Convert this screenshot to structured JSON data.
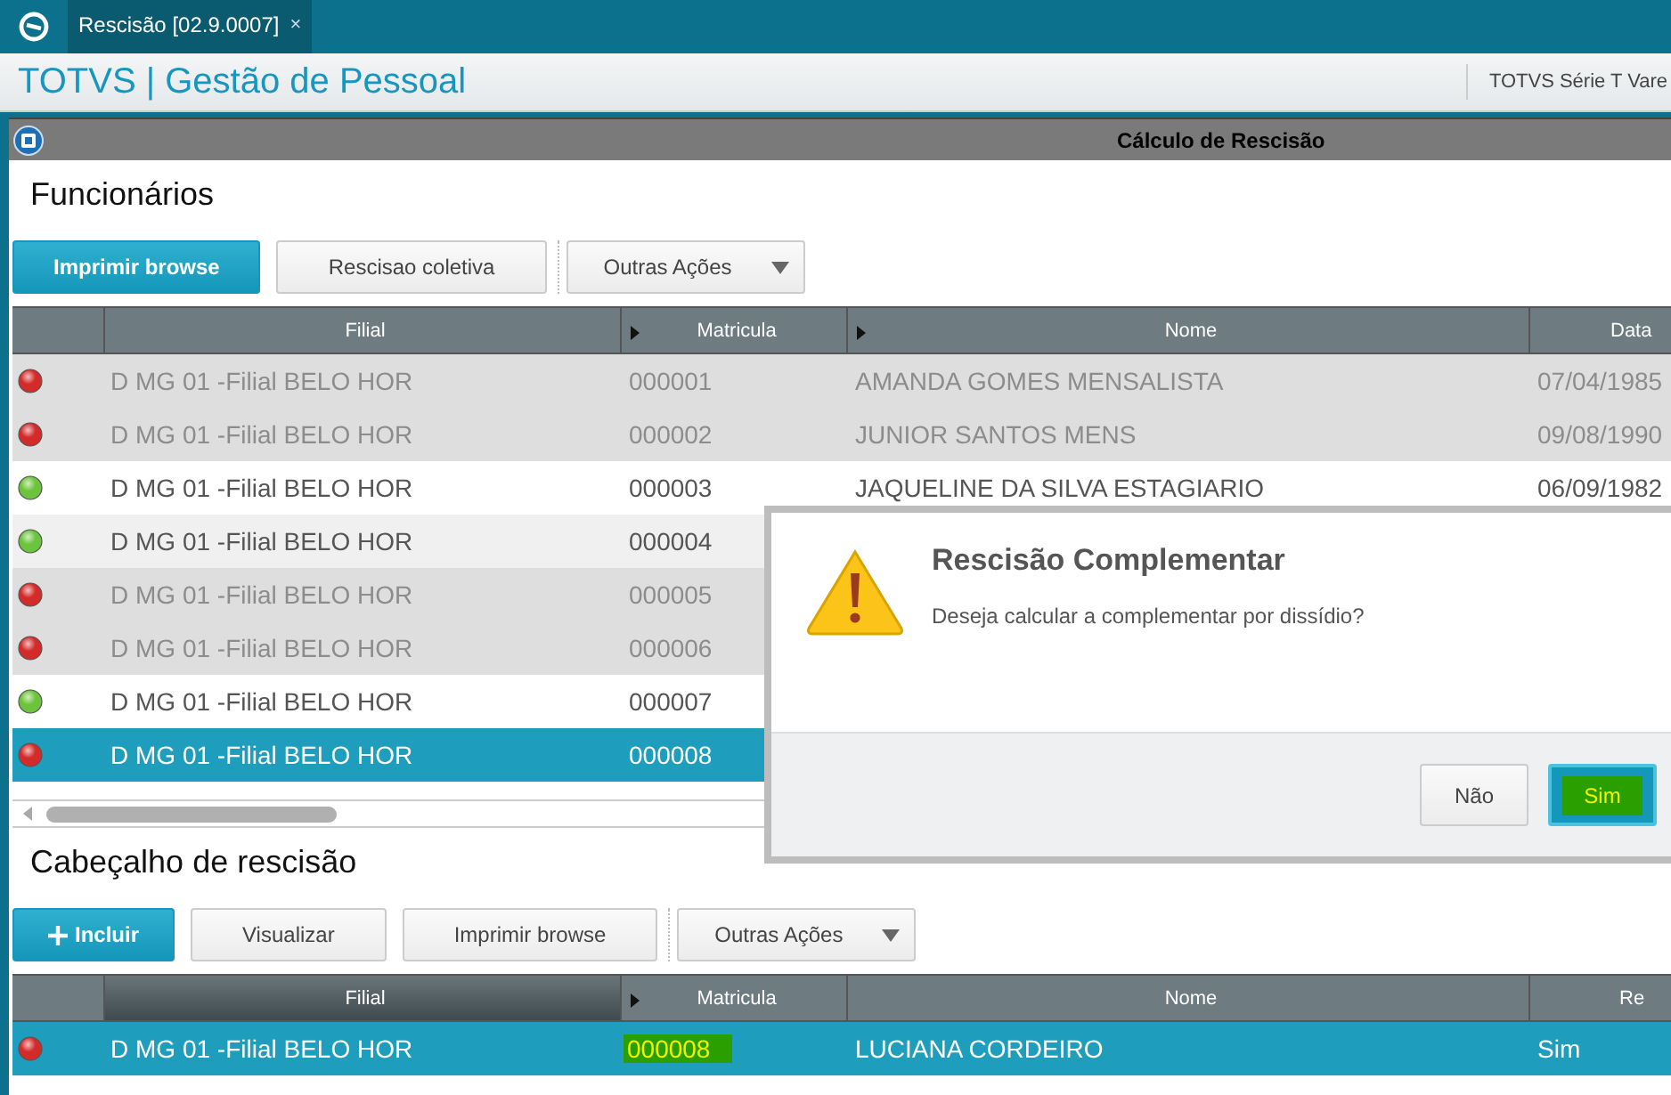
{
  "app_tabs": [
    {
      "label": "Rescisão [02.9.0007]",
      "close": "×",
      "selected": true
    }
  ],
  "header": {
    "title": "TOTVS | Gestão de Pessoal",
    "environment": "TOTVS Série T Vare"
  },
  "window": {
    "title": "Cálculo de Rescisão"
  },
  "employees": {
    "title": "Funcionários",
    "buttons": [
      {
        "label": "Imprimir browse",
        "kind": "primary"
      },
      {
        "label": "Rescisao coletiva",
        "kind": "plain"
      },
      {
        "label": "Outras Ações",
        "kind": "dropdown"
      }
    ],
    "columns": [
      {
        "label": "Filial",
        "sort": false
      },
      {
        "label": "Matricula",
        "sort": true
      },
      {
        "label": "Nome",
        "sort": true
      },
      {
        "label": "Data",
        "sort": false
      }
    ],
    "rows": [
      {
        "color": "#d42a2a",
        "dimmed": true,
        "selected": false,
        "cells": [
          "D MG 01 -Filial BELO HOR",
          "000001",
          "AMANDA GOMES MENSALISTA",
          "07/04/1985"
        ]
      },
      {
        "color": "#d42a2a",
        "dimmed": true,
        "selected": false,
        "cells": [
          "D MG 01 -Filial BELO HOR",
          "000002",
          "JUNIOR SANTOS MENS",
          "09/08/1990"
        ]
      },
      {
        "color": "#6cc43c",
        "dimmed": false,
        "selected": false,
        "cells": [
          "D MG 01 -Filial BELO HOR",
          "000003",
          "JAQUELINE DA SILVA ESTAGIARIO",
          "06/09/1982"
        ]
      },
      {
        "color": "#6cc43c",
        "dimmed": false,
        "selected": false,
        "cells": [
          "D MG 01 -Filial BELO HOR",
          "000004"
        ]
      },
      {
        "color": "#d42a2a",
        "dimmed": true,
        "selected": false,
        "cells": [
          "D MG 01 -Filial BELO HOR",
          "000005"
        ]
      },
      {
        "color": "#d42a2a",
        "dimmed": true,
        "selected": false,
        "cells": [
          "D MG 01 -Filial BELO HOR",
          "000006"
        ]
      },
      {
        "color": "#6cc43c",
        "dimmed": false,
        "selected": false,
        "cells": [
          "D MG 01 -Filial BELO HOR",
          "000007"
        ]
      },
      {
        "color": "#d42a2a",
        "selected": true,
        "cells": [
          "D MG 01 -Filial BELO HOR",
          "000008"
        ]
      }
    ]
  },
  "termination_header": {
    "title": "Cabeçalho de rescisão",
    "buttons": [
      {
        "label": "Incluir",
        "kind": "add"
      },
      {
        "label": "Visualizar",
        "kind": "plain"
      },
      {
        "label": "Imprimir browse",
        "kind": "plain"
      },
      {
        "label": "Outras Ações",
        "kind": "dropdown"
      }
    ],
    "columns": [
      {
        "label": "Filial",
        "sort": false
      },
      {
        "label": "Matricula",
        "sort": true
      },
      {
        "label": "Nome",
        "sort": false
      },
      {
        "label": "Re",
        "sort": false
      }
    ],
    "rows": [
      {
        "color": "#d42a2a",
        "selected": true,
        "highlighted": true,
        "cells": [
          "D MG 01 -Filial BELO HOR",
          "000008",
          "LUCIANA CORDEIRO",
          "Sim"
        ]
      }
    ]
  },
  "dialog": {
    "title": "Rescisão Complementar",
    "message": "Deseja calcular a complementar por dissídio?",
    "buttons": [
      {
        "label": "Não",
        "kind": "plain",
        "highlighted": false
      },
      {
        "label": "Sim",
        "kind": "primary",
        "highlighted": true
      }
    ]
  }
}
